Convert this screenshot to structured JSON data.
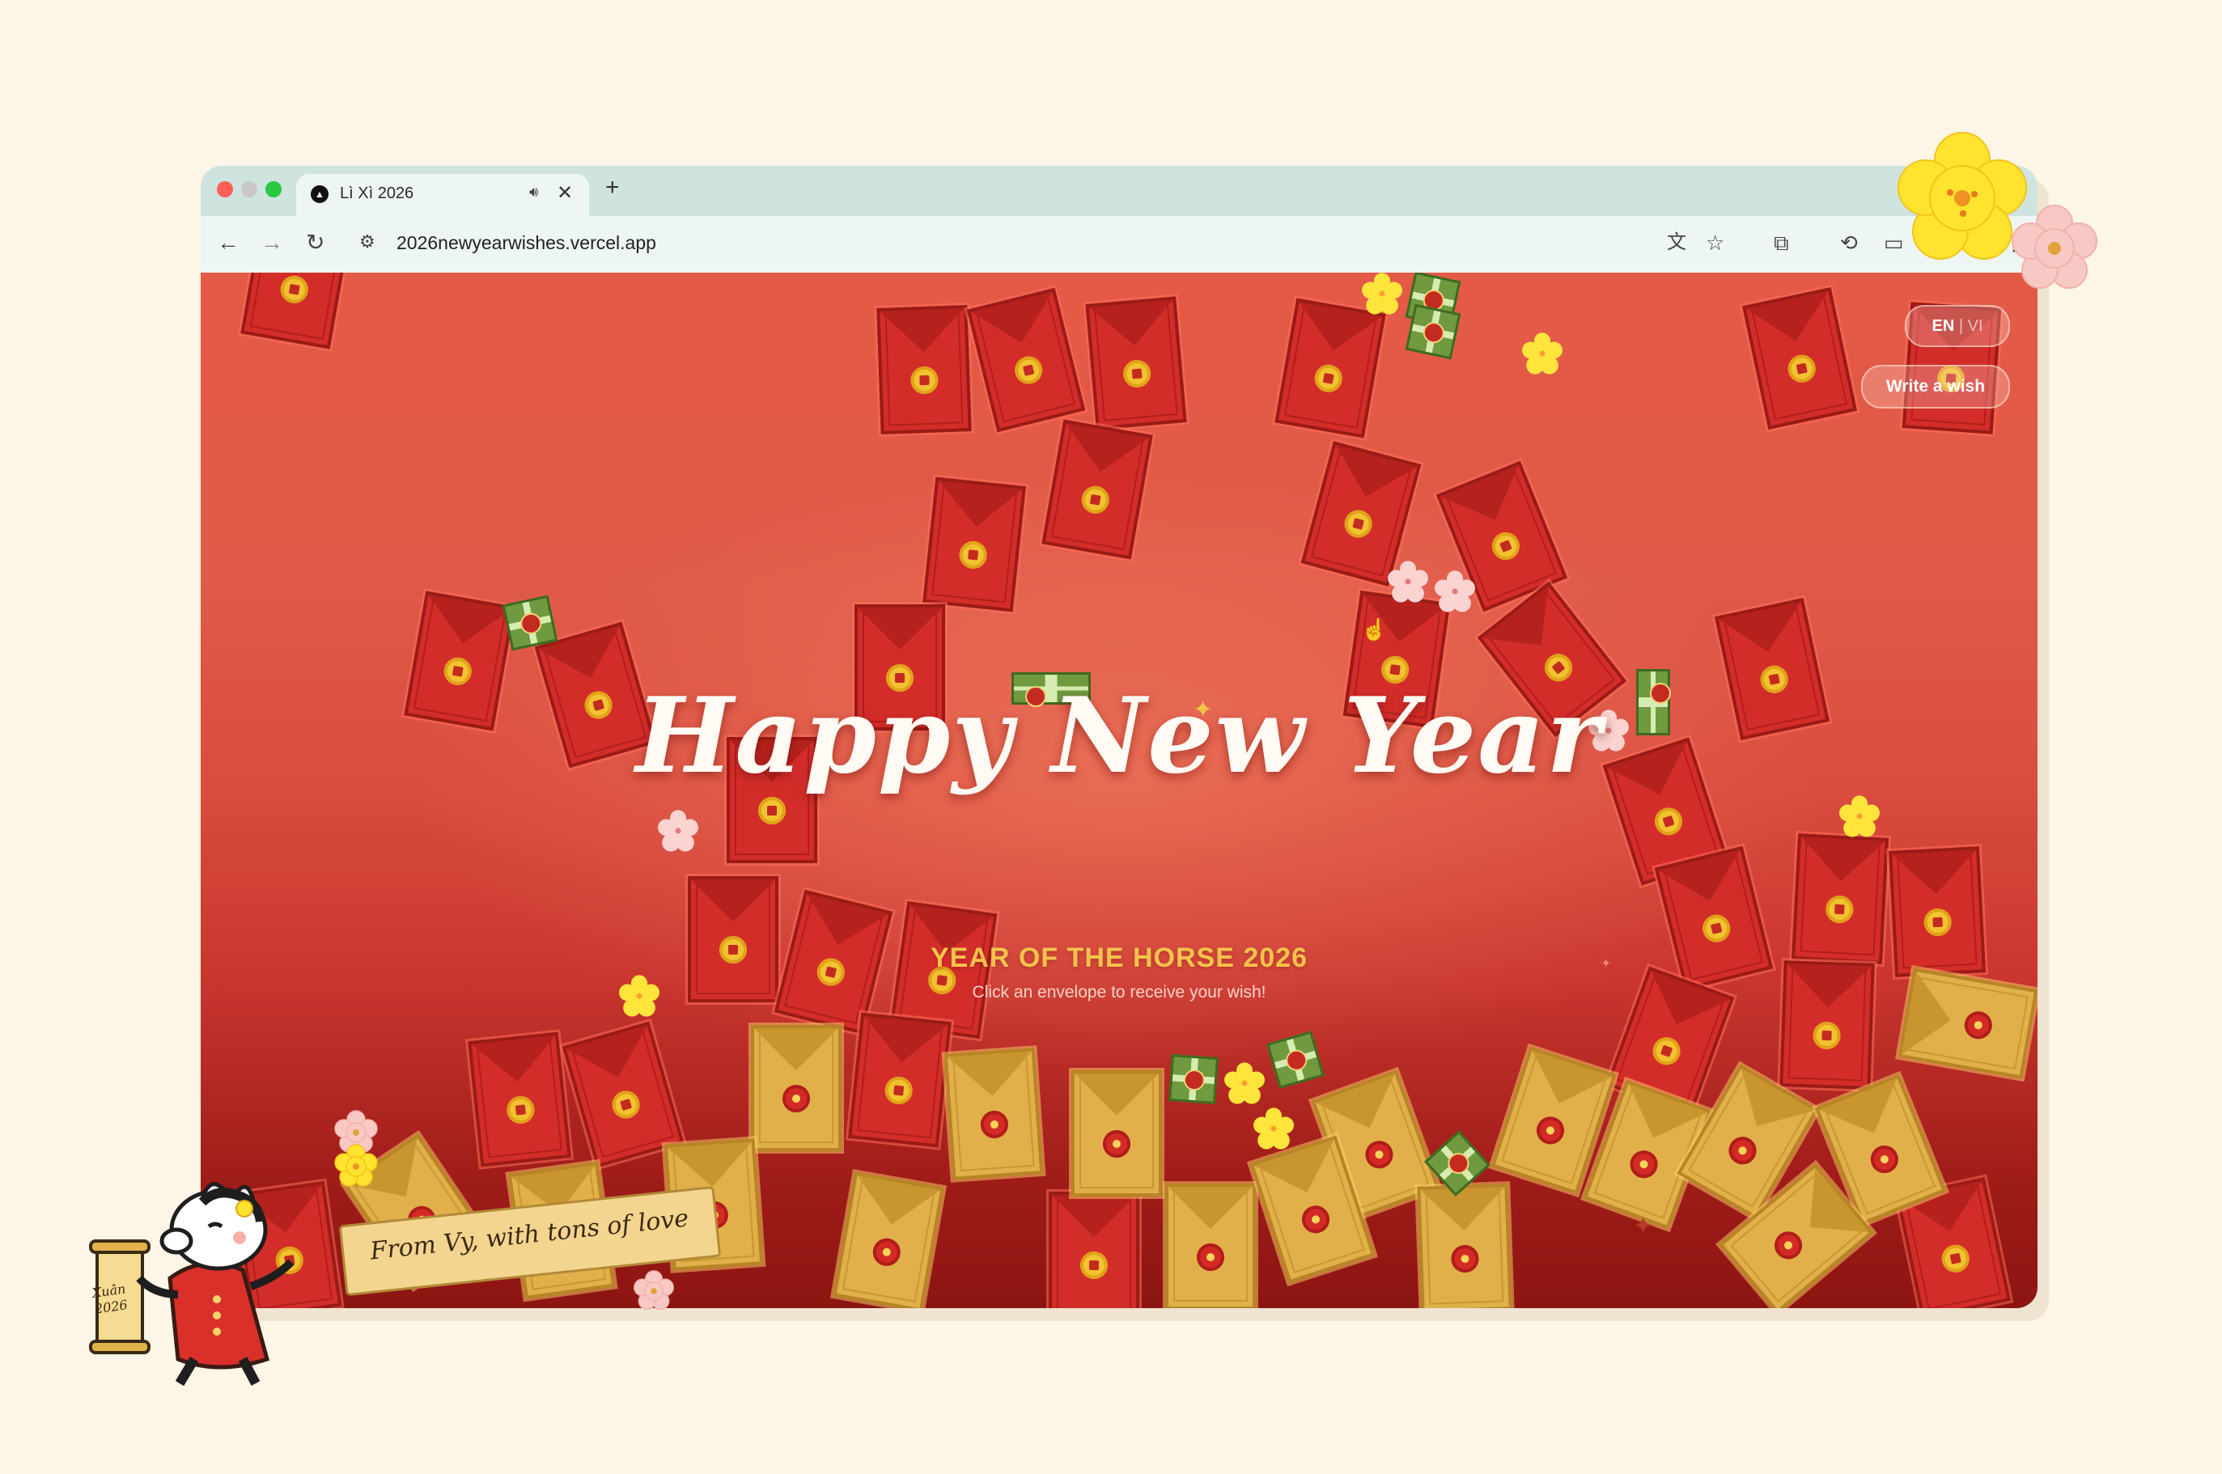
{
  "browser": {
    "tab_title": "Lì Xì 2026",
    "new_tab_label": "+",
    "close_tab_label": "✕",
    "url": "2026newyearwishes.vercel.app"
  },
  "page": {
    "title": "Happy New Year",
    "subtitle": "YEAR OF THE HORSE 2026",
    "hint": "Click an envelope to receive your wish!",
    "lang_en": "EN",
    "lang_sep": "|",
    "lang_vi": "VI",
    "write_wish_label": "Write a wish"
  },
  "signature": {
    "ribbon_text": "From Vy, with tons of love",
    "scroll_text": "Xuân 2026"
  },
  "colors": {
    "background": "#fdf5e6",
    "page_red": "#d94c3e",
    "envelope_red": "#d32d2a",
    "envelope_gold": "#e1b04b",
    "accent_gold": "#f6c24c"
  }
}
